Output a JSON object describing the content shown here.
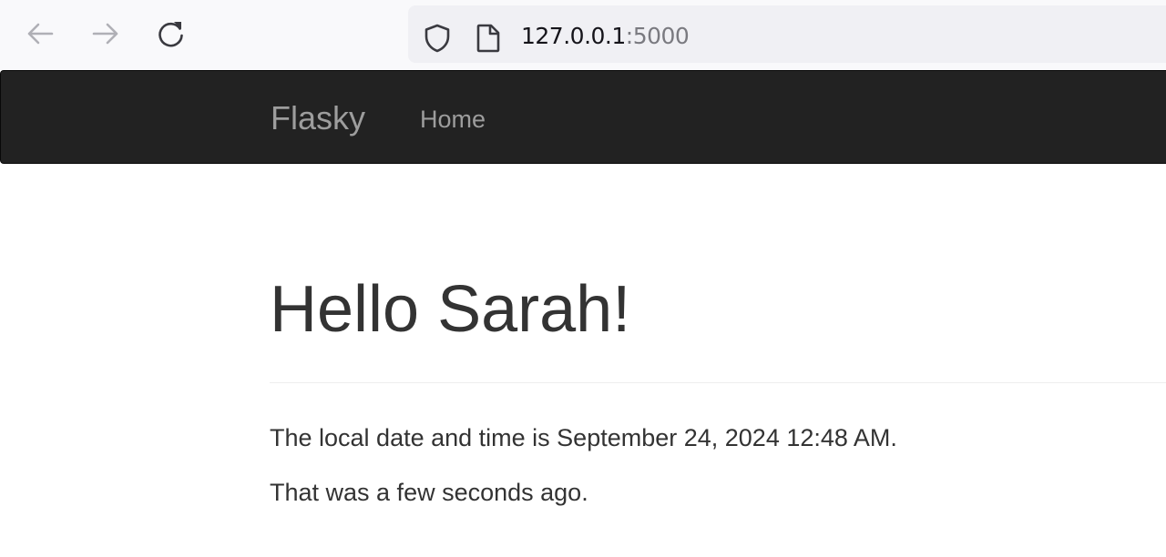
{
  "browser": {
    "url_host": "127.0.0.1",
    "url_port": ":5000",
    "icons": {
      "back": "back-arrow-icon",
      "forward": "forward-arrow-icon",
      "reload": "reload-icon",
      "shield": "shield-icon",
      "page": "page-icon"
    }
  },
  "navbar": {
    "brand": "Flasky",
    "links": [
      {
        "label": "Home"
      }
    ]
  },
  "main": {
    "title": "Hello Sarah!",
    "datetime_text": "The local date and time is September 24, 2024 12:48 AM.",
    "relative_text": "That was a few seconds ago."
  },
  "colors": {
    "navbar_bg": "#222222",
    "navbar_text": "#9d9d9d",
    "body_text": "#333333",
    "toolbar_bg": "#f9f9fb",
    "urlbar_bg": "#f0f0f4"
  }
}
